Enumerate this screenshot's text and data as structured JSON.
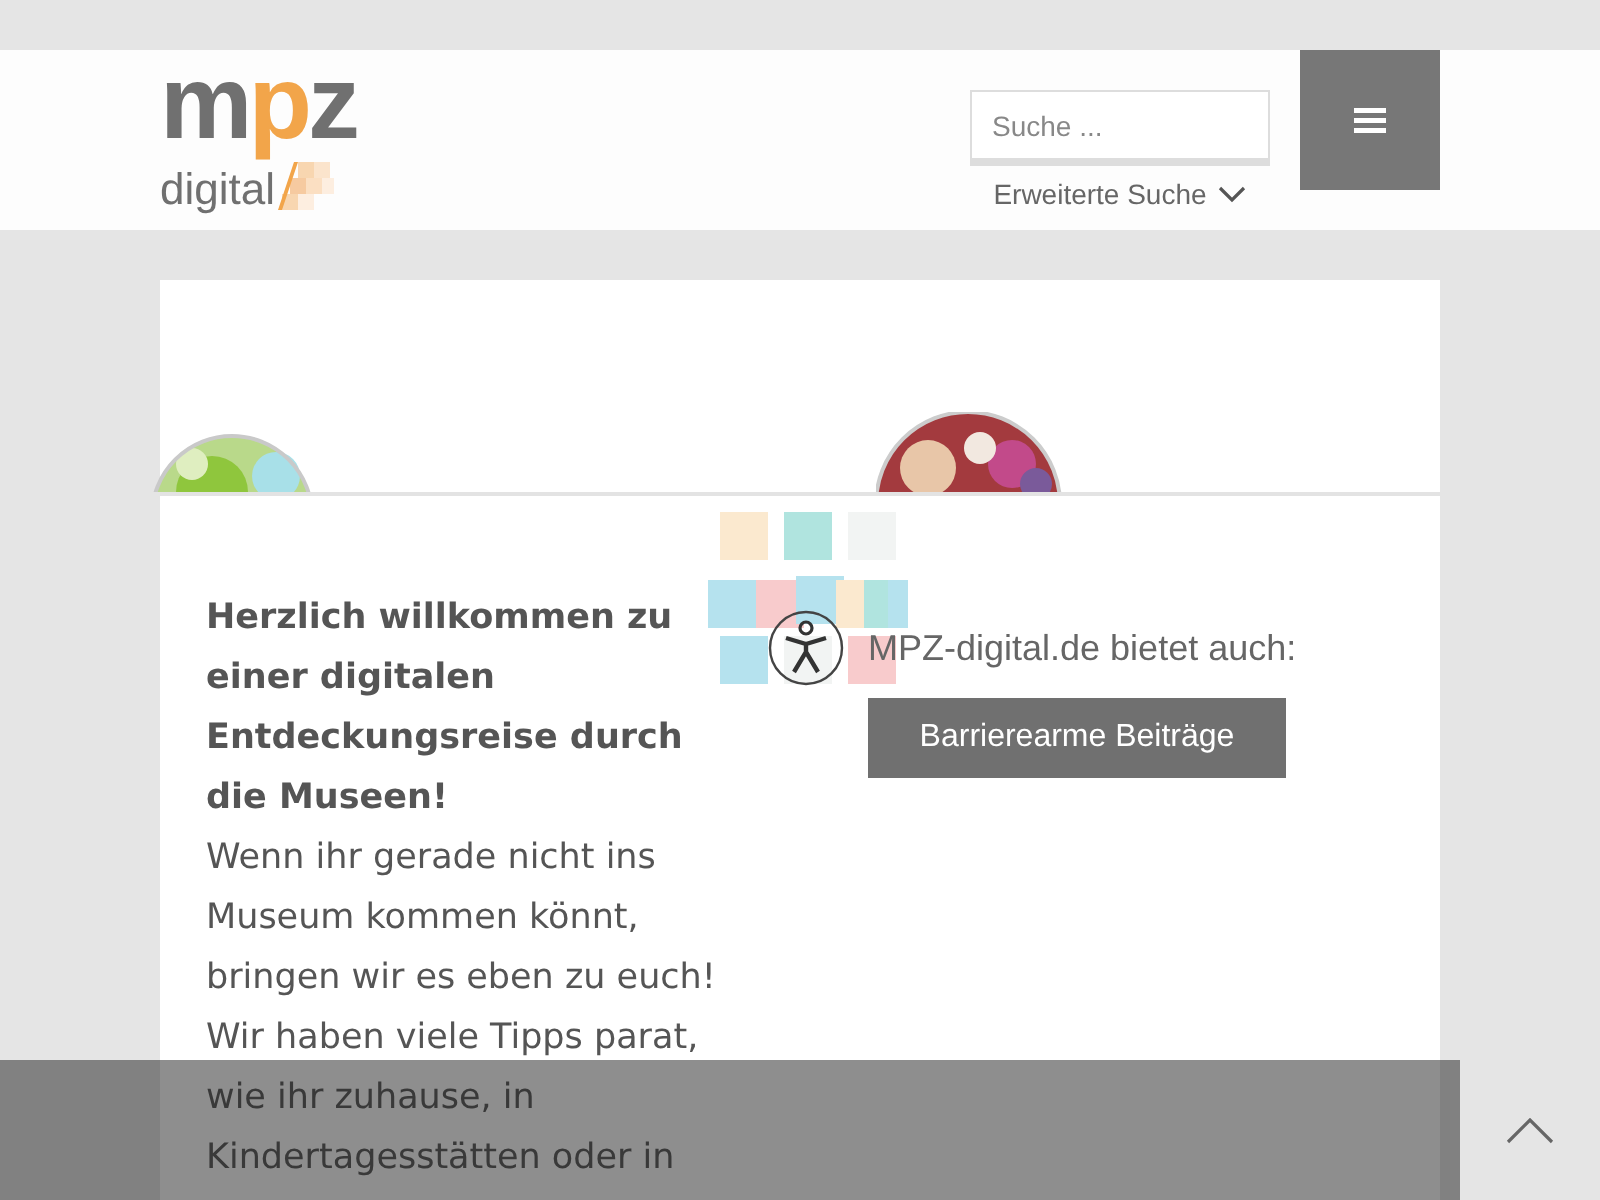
{
  "header": {
    "logo": {
      "wordmark": [
        {
          "text": "m",
          "accent": false
        },
        {
          "text": "p",
          "accent": true
        },
        {
          "text": "z",
          "accent": false
        }
      ],
      "tagline": "digital"
    },
    "search": {
      "placeholder": "Suche ..."
    },
    "advanced_search": "Erweiterte Suche"
  },
  "intro": {
    "heading": "Herzlich willkommen zu einer digitalen Entdeckungsreise durch die Museen!",
    "text": "Wenn ihr gerade nicht ins Museum kommen könnt, bringen wir es eben zu euch! Wir haben viele Tipps parat, wie ihr zuhause, in Kindertagesstätten oder in"
  },
  "offer": {
    "label": "MPZ-digital.de bietet auch:",
    "button": "Barrierearme Beiträge"
  }
}
